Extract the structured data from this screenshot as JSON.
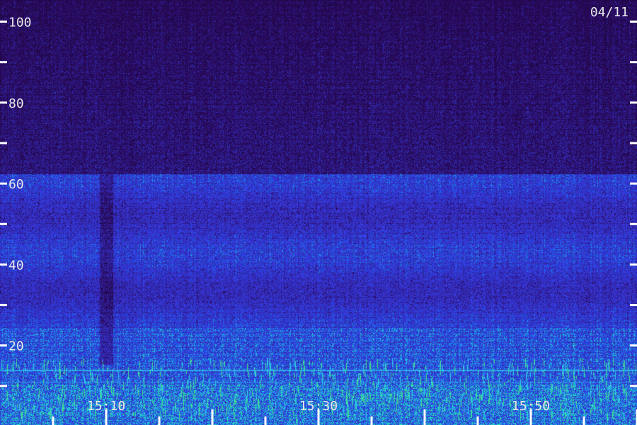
{
  "chart_data": {
    "type": "heatmap",
    "title": "",
    "xlabel": "",
    "ylabel": "",
    "date": "04/11",
    "y_range": [
      0,
      105
    ],
    "y_tick_values": [
      100,
      80,
      60,
      40,
      20
    ],
    "y_minor_tick_values": [
      10,
      30,
      50,
      70,
      90
    ],
    "x_tick_labels": [
      "15:10",
      "15:30",
      "15:50"
    ],
    "x_range_minutes": [
      "15:05",
      "16:05"
    ],
    "colors": {
      "background": "#1a0a3a",
      "low": "#3a1a8a",
      "mid": "#2a3ae0",
      "high": "#30c8e8",
      "peak": "#40e090",
      "ticks": "#ffffff"
    }
  }
}
